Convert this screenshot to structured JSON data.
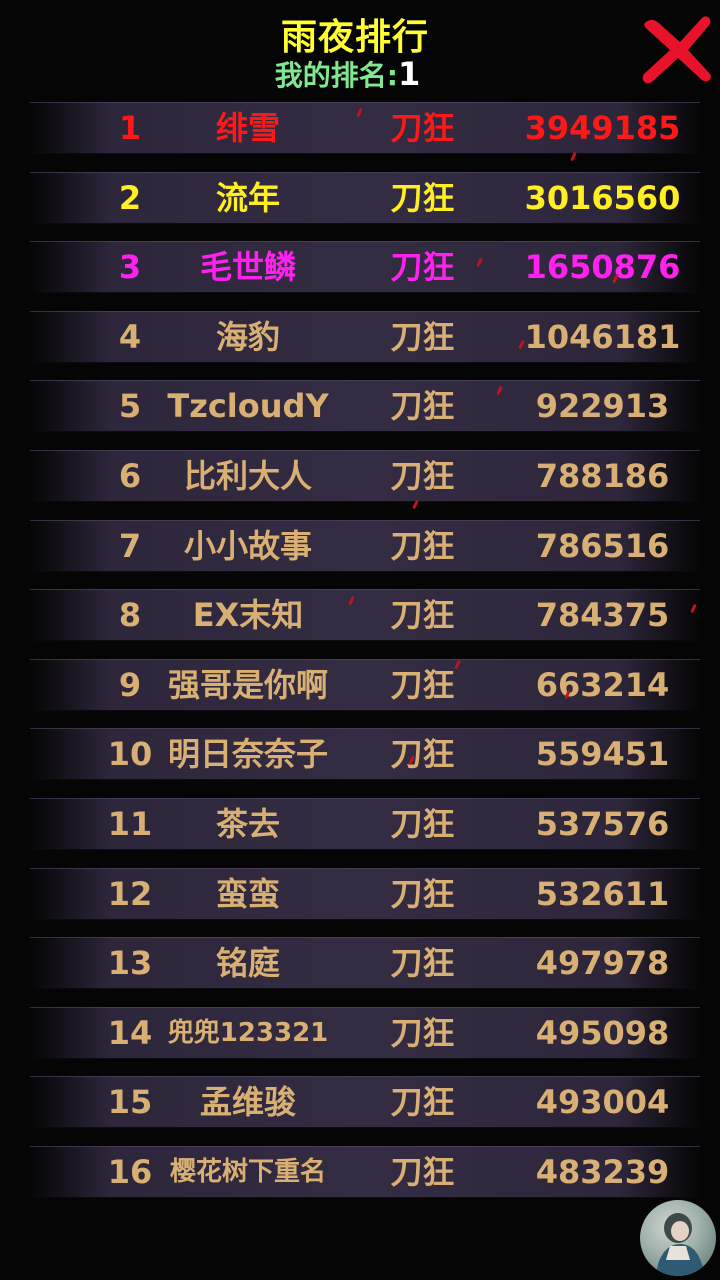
{
  "header": {
    "title": "雨夜排行",
    "my_rank_label": "我的排名:",
    "my_rank_value": "1"
  },
  "colors": {
    "rank1": "#ff1818",
    "rank2": "#ffee22",
    "rank3": "#ff22ee",
    "default_text": "#d9b074",
    "title": "#ffff33",
    "my_rank_label": "#7fe890",
    "close_icon": "#e8132a"
  },
  "icons": {
    "close": "close-x-icon",
    "avatar": "player-avatar-icon"
  },
  "leaderboard": [
    {
      "rank": "1",
      "name": "绯雪",
      "class": "刀狂",
      "score": "3949185"
    },
    {
      "rank": "2",
      "name": "流年",
      "class": "刀狂",
      "score": "3016560"
    },
    {
      "rank": "3",
      "name": "毛世鳞",
      "class": "刀狂",
      "score": "1650876"
    },
    {
      "rank": "4",
      "name": "海豹",
      "class": "刀狂",
      "score": "1046181"
    },
    {
      "rank": "5",
      "name": "TzcloudY",
      "class": "刀狂",
      "score": "922913"
    },
    {
      "rank": "6",
      "name": "比利大人",
      "class": "刀狂",
      "score": "788186"
    },
    {
      "rank": "7",
      "name": "小小故事",
      "class": "刀狂",
      "score": "786516"
    },
    {
      "rank": "8",
      "name": "EX末知",
      "class": "刀狂",
      "score": "784375"
    },
    {
      "rank": "9",
      "name": "强哥是你啊",
      "class": "刀狂",
      "score": "663214"
    },
    {
      "rank": "10",
      "name": "明日奈奈子",
      "class": "刀狂",
      "score": "559451"
    },
    {
      "rank": "11",
      "name": "茶去",
      "class": "刀狂",
      "score": "537576"
    },
    {
      "rank": "12",
      "name": "蛮蛮",
      "class": "刀狂",
      "score": "532611"
    },
    {
      "rank": "13",
      "name": "铭庭",
      "class": "刀狂",
      "score": "497978"
    },
    {
      "rank": "14",
      "name": "兜兜123321",
      "class": "刀狂",
      "score": "495098"
    },
    {
      "rank": "15",
      "name": "孟维骏",
      "class": "刀狂",
      "score": "493004"
    },
    {
      "rank": "16",
      "name": "樱花树下重名",
      "class": "刀狂",
      "score": "483239"
    }
  ]
}
